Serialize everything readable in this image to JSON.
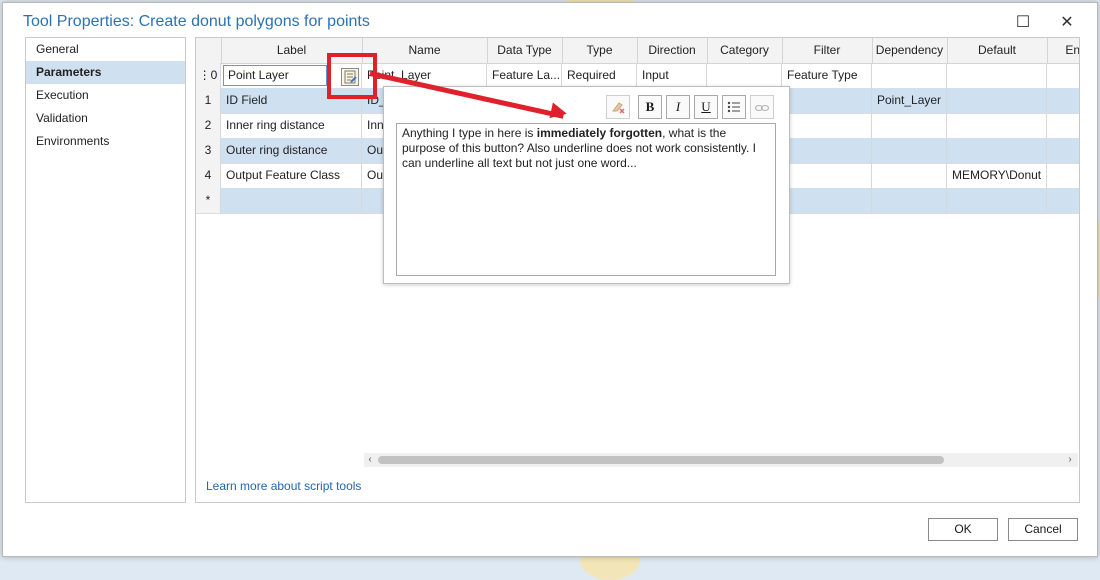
{
  "window": {
    "title": "Tool Properties: Create donut polygons for points",
    "maximize_glyph": "☐",
    "close_glyph": "✕"
  },
  "nav": {
    "items": [
      {
        "label": "General",
        "active": false
      },
      {
        "label": "Parameters",
        "active": true
      },
      {
        "label": "Execution",
        "active": false
      },
      {
        "label": "Validation",
        "active": false
      },
      {
        "label": "Environments",
        "active": false
      }
    ]
  },
  "grid": {
    "headers": [
      "Label",
      "Name",
      "Data Type",
      "Type",
      "Direction",
      "Category",
      "Filter",
      "Dependency",
      "Default",
      "Envi"
    ],
    "rows": [
      {
        "num": "0",
        "label": "Point Layer",
        "name": "Point_Layer",
        "data_type": "Feature La...",
        "type": "Required",
        "direction": "Input",
        "category": "",
        "filter": "Feature Type",
        "dependency": "",
        "default": ""
      },
      {
        "num": "1",
        "label": "ID Field",
        "name": "ID_",
        "data_type": "",
        "type": "",
        "direction": "",
        "category": "",
        "filter": "",
        "dependency": "Point_Layer",
        "default": ""
      },
      {
        "num": "2",
        "label": "Inner ring distance",
        "name": "Inn",
        "data_type": "",
        "type": "",
        "direction": "",
        "category": "",
        "filter": "",
        "dependency": "",
        "default": ""
      },
      {
        "num": "3",
        "label": "Outer ring distance",
        "name": "Out",
        "data_type": "",
        "type": "",
        "direction": "",
        "category": "",
        "filter": "",
        "dependency": "",
        "default": ""
      },
      {
        "num": "4",
        "label": "Output Feature Class",
        "name": "Out",
        "data_type": "",
        "type": "",
        "direction": "",
        "category": "",
        "filter": "",
        "dependency": "",
        "default": "MEMORY\\Donut"
      },
      {
        "num": "*",
        "label": "",
        "name": "",
        "data_type": "",
        "type": "",
        "direction": "",
        "category": "",
        "filter": "",
        "dependency": "",
        "default": ""
      }
    ]
  },
  "popup": {
    "toolbar": {
      "bold": "B",
      "italic": "I",
      "underline": "U"
    },
    "text_parts": {
      "before": "Anything I type in here is ",
      "bold": "immediately forgotten",
      "after": ", what is the purpose of this button? Also underline does not work consistently. I can underline all text but not just one word..."
    }
  },
  "links": {
    "learn_more": "Learn more about script tools"
  },
  "buttons": {
    "ok": "OK",
    "cancel": "Cancel"
  },
  "colors": {
    "title": "#2b72b5",
    "selection": "#cfe0f0",
    "callout": "#e0202a",
    "link": "#1f65b3"
  }
}
